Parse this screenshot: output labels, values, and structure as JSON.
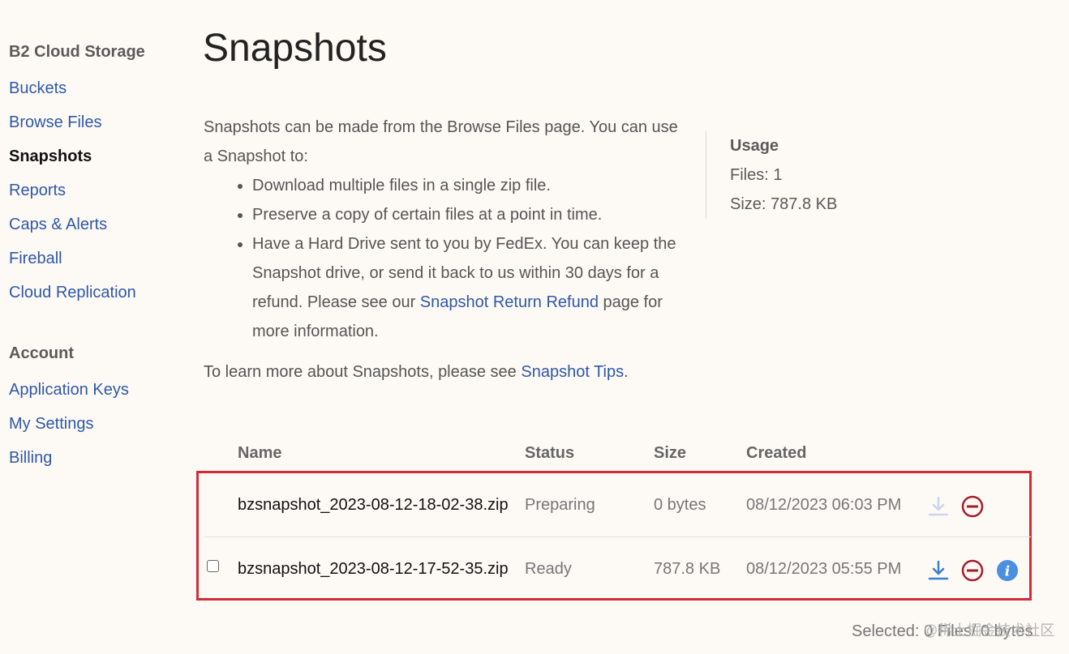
{
  "sidebar": {
    "section1_title": "B2 Cloud Storage",
    "items": [
      {
        "label": "Buckets"
      },
      {
        "label": "Browse Files"
      },
      {
        "label": "Snapshots"
      },
      {
        "label": "Reports"
      },
      {
        "label": "Caps & Alerts"
      },
      {
        "label": "Fireball"
      },
      {
        "label": "Cloud Replication"
      }
    ],
    "section2_title": "Account",
    "account_items": [
      {
        "label": "Application Keys"
      },
      {
        "label": "My Settings"
      },
      {
        "label": "Billing"
      }
    ]
  },
  "page": {
    "title": "Snapshots",
    "intro": "Snapshots can be made from the Browse Files page. You can use a Snapshot to:",
    "bullets": [
      "Download multiple files in a single zip file.",
      "Preserve a copy of certain files at a point in time."
    ],
    "bullet3_pre": "Have a Hard Drive sent to you by FedEx. You can keep the Snapshot drive, or send it back to us within 30 days for a refund. Please see our ",
    "bullet3_link": "Snapshot Return Refund",
    "bullet3_post": " page for more information.",
    "tips_pre": "To learn more about Snapshots, please see ",
    "tips_link": "Snapshot Tips",
    "tips_post": "."
  },
  "usage": {
    "title": "Usage",
    "files": "Files: 1",
    "size": "Size: 787.8 KB"
  },
  "table": {
    "headers": {
      "name": "Name",
      "status": "Status",
      "size": "Size",
      "created": "Created"
    },
    "rows": [
      {
        "name": "bzsnapshot_2023-08-12-18-02-38.zip",
        "status": "Preparing",
        "size": "0 bytes",
        "created": "08/12/2023 06:03 PM"
      },
      {
        "name": "bzsnapshot_2023-08-12-17-52-35.zip",
        "status": "Ready",
        "size": "787.8 KB",
        "created": "08/12/2023 05:55 PM"
      }
    ]
  },
  "footer": {
    "selected": "Selected: 0 Files/ 0 bytes",
    "watermark": "@稀土掘金技术社区"
  },
  "colors": {
    "link": "#2f58a8",
    "highlight_border": "#d42a37",
    "delete_icon": "#a51c2a",
    "info_icon": "#4a8fe0",
    "download_icon": "#3c7fd0"
  },
  "icons": [
    "download-icon",
    "delete-icon",
    "info-icon"
  ]
}
